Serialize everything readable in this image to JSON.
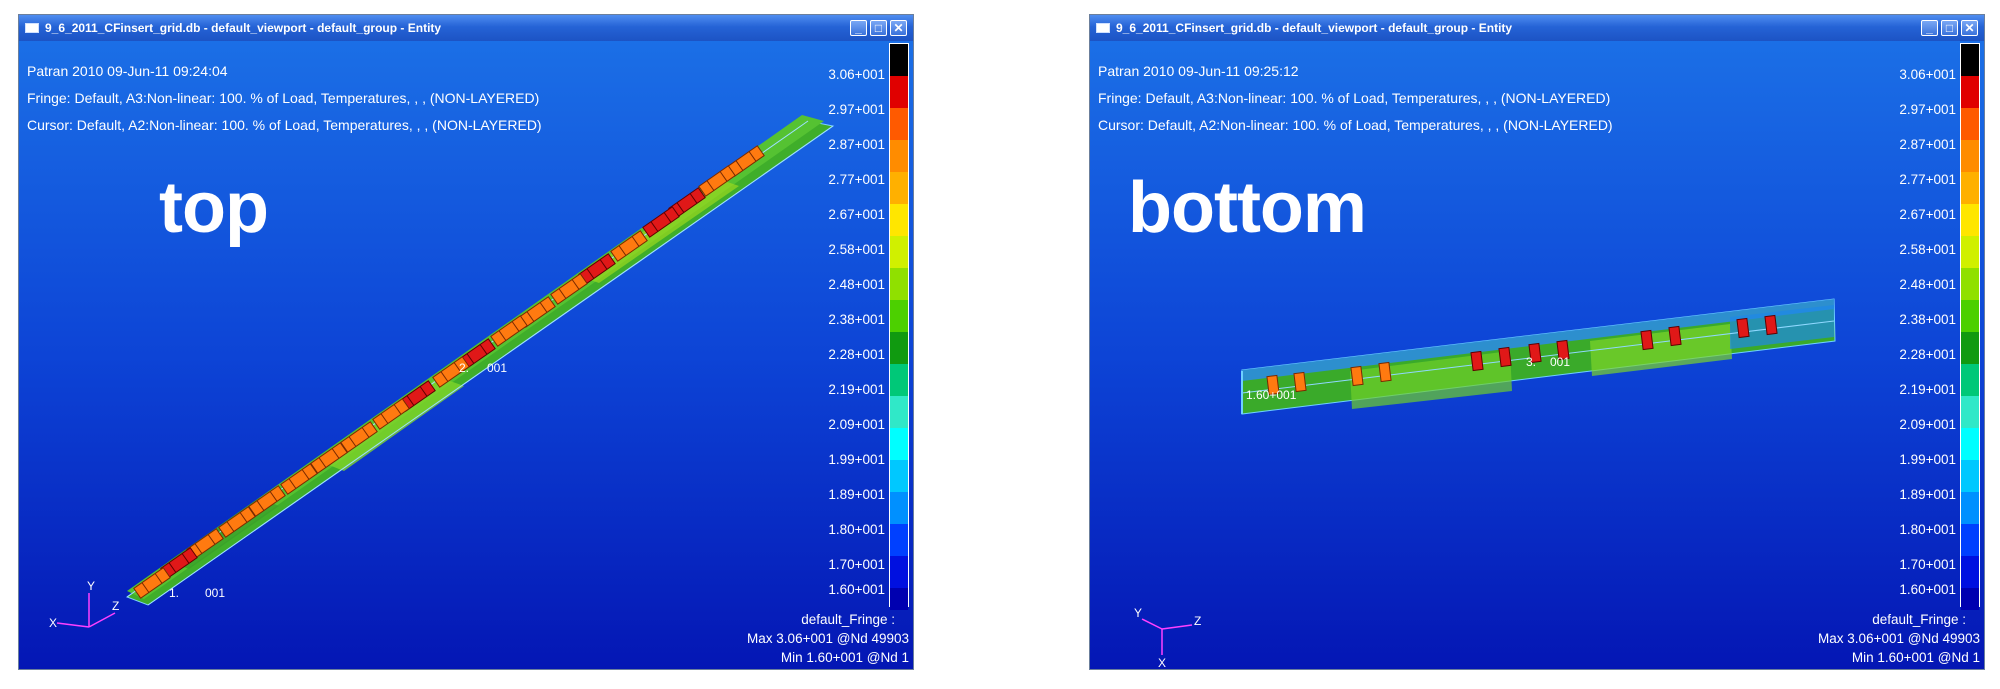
{
  "left_window": {
    "title": "9_6_2011_CFinsert_grid.db - default_viewport - default_group - Entity",
    "info": [
      "Patran 2010 09-Jun-11 09:24:04",
      "Fringe: Default, A3:Non-linear: 100. % of Load, Temperatures, , , (NON-LAYERED)",
      "Cursor: Default, A2:Non-linear: 100. % of Load, Temperatures, , , (NON-LAYERED)"
    ],
    "label": "top",
    "cursor_labels": [
      "2.",
      "001",
      "1.",
      "001"
    ],
    "axis_labels": {
      "y": "Y",
      "z": "Z",
      "x": "X"
    },
    "footer": [
      "default_Fringe :",
      "Max 3.06+001 @Nd 49903",
      "Min 1.60+001 @Nd 1"
    ]
  },
  "right_window": {
    "title": "9_6_2011_CFinsert_grid.db - default_viewport - default_group - Entity",
    "info": [
      "Patran 2010 09-Jun-11 09:25:12",
      "Fringe: Default, A3:Non-linear: 100. % of Load, Temperatures, , , (NON-LAYERED)",
      "Cursor: Default, A2:Non-linear: 100. % of Load, Temperatures, , , (NON-LAYERED)"
    ],
    "label": "bottom",
    "cursor_labels": [
      "1.60+001",
      "3.",
      "001"
    ],
    "axis_labels": {
      "y": "Y",
      "z": "Z",
      "x": "X"
    },
    "footer": [
      "default_Fringe :",
      "Max 3.06+001 @Nd 49903",
      "Min 1.60+001 @Nd 1"
    ]
  },
  "legend": {
    "values": [
      "3.06+001",
      "2.97+001",
      "2.87+001",
      "2.77+001",
      "2.67+001",
      "2.58+001",
      "2.48+001",
      "2.38+001",
      "2.28+001",
      "2.19+001",
      "2.09+001",
      "1.99+001",
      "1.89+001",
      "1.80+001",
      "1.70+001",
      "1.60+001"
    ],
    "colors": [
      "#000000",
      "#e00000",
      "#ff5a00",
      "#ff8c00",
      "#ffb000",
      "#ffe600",
      "#d0f000",
      "#90e000",
      "#4cd000",
      "#109a10",
      "#00c878",
      "#30e8c8",
      "#00ffff",
      "#00c8ff",
      "#0090ff",
      "#0040ff",
      "#0010e0",
      "#0000b0"
    ]
  },
  "window_controls": {
    "minimize": "_",
    "maximize": "□",
    "close": "✕"
  }
}
